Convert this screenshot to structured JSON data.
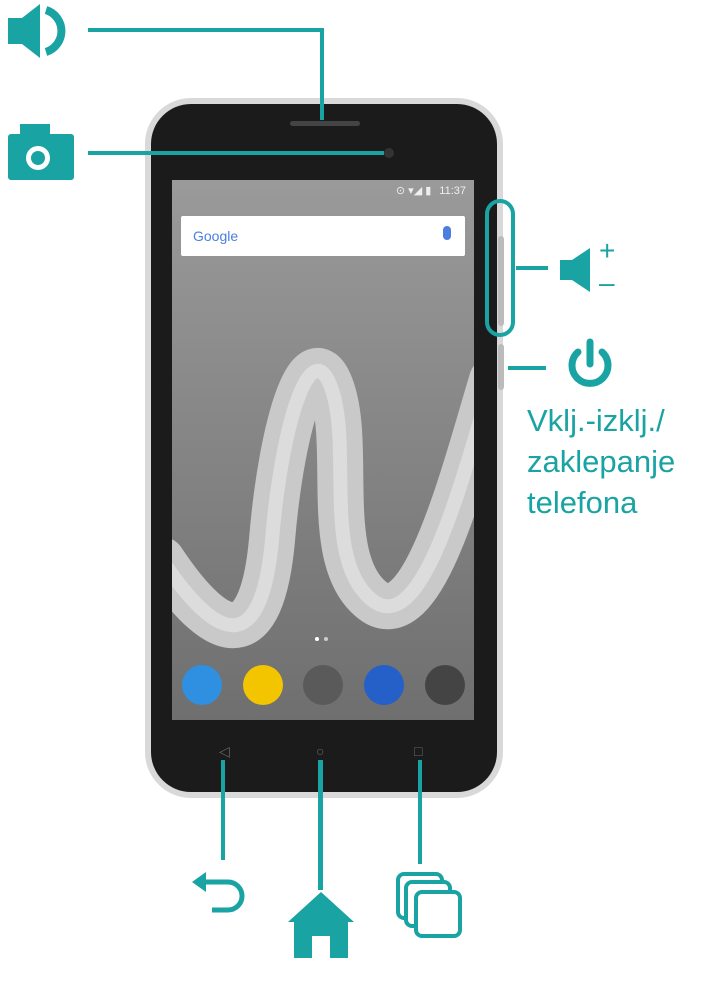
{
  "colors": {
    "accent": "#1aa3a3",
    "bezel": "#1b1b1b",
    "frame": "#d9d9d9"
  },
  "labels": {
    "power_line1": "Vklj.-izklj./",
    "power_line2": "zaklepanje",
    "power_line3": "telefona",
    "volume_plus": "+",
    "volume_minus": "–"
  },
  "phone_screen": {
    "status_time": "11:37",
    "search_brand": "Google"
  },
  "icons": [
    "speaker-icon",
    "camera-icon",
    "volume-icon",
    "power-icon",
    "back-icon",
    "home-icon",
    "recent-apps-icon"
  ],
  "dock_apps": [
    "phone-app-icon",
    "messages-app-icon",
    "apps-drawer-icon",
    "chat-app-icon",
    "camera-app-icon"
  ]
}
